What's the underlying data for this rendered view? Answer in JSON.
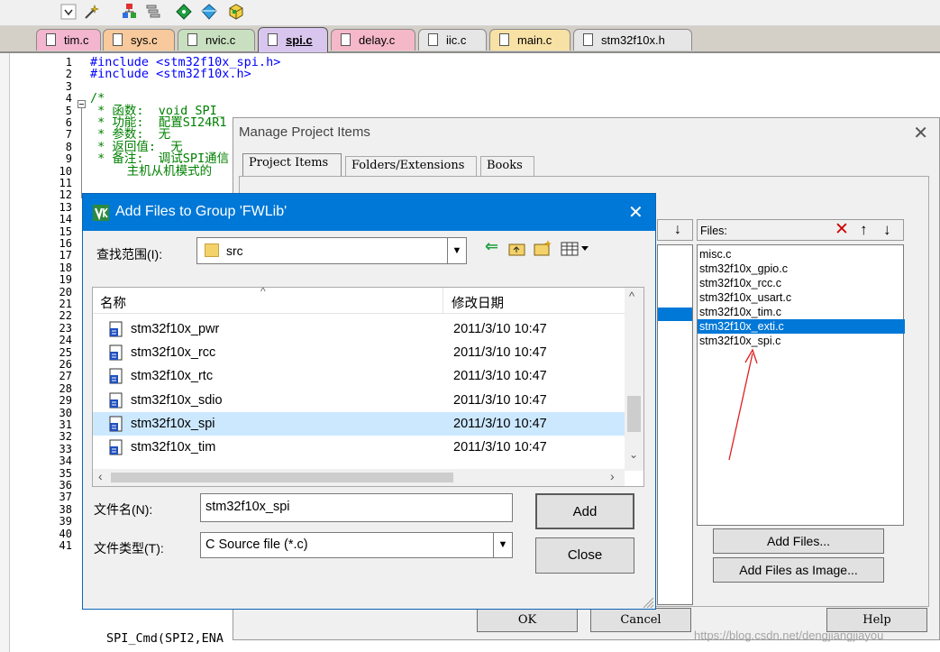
{
  "tabs": [
    "tim.c",
    "sys.c",
    "nvic.c",
    "spi.c",
    "delay.c",
    "iic.c",
    "main.c",
    "stm32f10x.h"
  ],
  "tab_colors": [
    "#f4b6cf",
    "#f7c99c",
    "#c9e0c0",
    "#d8c6ee",
    "#f5b8c8",
    "#e6e6e6",
    "#f7e1a5",
    "#e6e6e6"
  ],
  "editor": {
    "line_numbers": [
      "1",
      "2",
      "3",
      "4",
      "5",
      "6",
      "7",
      "8",
      "9",
      "10",
      "11",
      "12",
      "13",
      "14",
      "15",
      "16",
      "17",
      "18",
      "19",
      "20",
      "21",
      "22",
      "23",
      "24",
      "25",
      "26",
      "27",
      "28",
      "29",
      "30",
      "31",
      "32",
      "33",
      "34",
      "35",
      "36",
      "37",
      "38",
      "39",
      "40",
      "41"
    ],
    "lines": [
      {
        "cls": "c-dir",
        "text": "#include <stm32f10x_spi.h>"
      },
      {
        "cls": "c-dir",
        "text": "#include <stm32f10x.h>"
      },
      {
        "cls": "c-txt",
        "text": ""
      },
      {
        "cls": "c-cmt",
        "text": "/*"
      },
      {
        "cls": "c-cmt",
        "text": " * 函数:  void SPI_"
      },
      {
        "cls": "c-cmt",
        "text": " * 功能:  配置SI24R1"
      },
      {
        "cls": "c-cmt",
        "text": " * 参数:  无"
      },
      {
        "cls": "c-cmt",
        "text": " * 返回值:  无"
      },
      {
        "cls": "c-cmt",
        "text": " * 备注:  调试SPI通信"
      },
      {
        "cls": "c-cmt",
        "text": "     主机从机模式的"
      }
    ],
    "bottom_code": "SPI_Cmd(SPI2,ENA"
  },
  "manage": {
    "title": "Manage Project Items",
    "tabs": [
      "Project Items",
      "Folders/Extensions",
      "Books"
    ],
    "files_label": "Files:",
    "files": [
      "misc.c",
      "stm32f10x_gpio.c",
      "stm32f10x_rcc.c",
      "stm32f10x_usart.c",
      "stm32f10x_tim.c",
      "stm32f10x_exti.c",
      "stm32f10x_spi.c"
    ],
    "selected_file": 5,
    "add_files": "Add Files...",
    "add_files_image": "Add Files as Image...",
    "ok": "OK",
    "cancel": "Cancel",
    "help": "Help"
  },
  "add_dialog": {
    "title": "Add Files to Group 'FWLib'",
    "lookin_label": "查找范围(I):",
    "lookin_value": "src",
    "col_name": "名称",
    "col_date": "修改日期",
    "rows": [
      {
        "name": "stm32f10x_pwr",
        "date": "2011/3/10 10:47"
      },
      {
        "name": "stm32f10x_rcc",
        "date": "2011/3/10 10:47"
      },
      {
        "name": "stm32f10x_rtc",
        "date": "2011/3/10 10:47"
      },
      {
        "name": "stm32f10x_sdio",
        "date": "2011/3/10 10:47"
      },
      {
        "name": "stm32f10x_spi",
        "date": "2011/3/10 10:47"
      },
      {
        "name": "stm32f10x_tim",
        "date": "2011/3/10 10:47"
      }
    ],
    "selected_row": 4,
    "filename_label": "文件名(N):",
    "filename_value": "stm32f10x_spi",
    "filetype_label": "文件类型(T):",
    "filetype_value": "C Source file (*.c)",
    "add": "Add",
    "close": "Close"
  },
  "watermark": "https://blog.csdn.net/dengjiangjiayou"
}
